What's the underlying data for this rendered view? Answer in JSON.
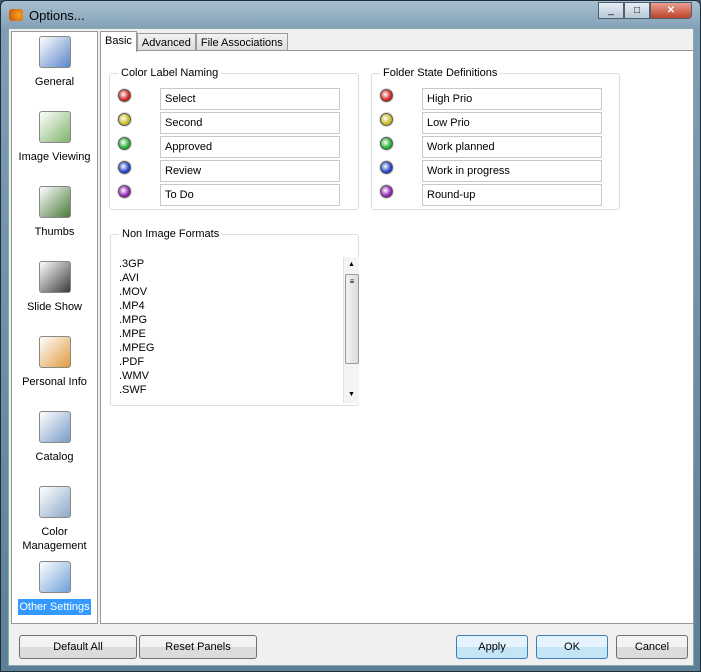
{
  "window": {
    "title": "Options...",
    "controls": [
      "minimize",
      "maximize",
      "close"
    ]
  },
  "sidebar": {
    "items": [
      {
        "label": "General",
        "icon": "general-window-icon",
        "color": "#5b86c9"
      },
      {
        "label": "Image Viewing",
        "icon": "image-viewing-icon",
        "color": "#7fb36a"
      },
      {
        "label": "Thumbs",
        "icon": "thumbs-icon",
        "color": "#4a7a3a"
      },
      {
        "label": "Slide Show",
        "icon": "slide-show-film-icon",
        "color": "#3a3a3a"
      },
      {
        "label": "Personal Info",
        "icon": "personal-info-person-icon",
        "color": "#e09a40"
      },
      {
        "label": "Catalog",
        "icon": "catalog-icon",
        "color": "#7a9cc8"
      },
      {
        "label": "Color Management",
        "icon": "color-management-monitor-icon",
        "color": "#8da8c8"
      },
      {
        "label": "Other Settings",
        "icon": "other-settings-tools-icon",
        "color": "#6fa0d8",
        "selected": true
      }
    ]
  },
  "tabs": [
    {
      "label": "Basic",
      "active": true
    },
    {
      "label": "Advanced"
    },
    {
      "label": "File Associations"
    }
  ],
  "color_label_naming": {
    "title": "Color Label Naming",
    "items": [
      {
        "color": "#d02020",
        "value": "Select"
      },
      {
        "color": "#c8b820",
        "value": "Second"
      },
      {
        "color": "#20b030",
        "value": "Approved"
      },
      {
        "color": "#2040c8",
        "value": "Review"
      },
      {
        "color": "#9020b0",
        "value": "To Do"
      }
    ]
  },
  "folder_state": {
    "title": "Folder State Definitions",
    "items": [
      {
        "color": "#d02020",
        "value": "High Prio"
      },
      {
        "color": "#c8b820",
        "value": "Low Prio"
      },
      {
        "color": "#20b030",
        "value": "Work planned"
      },
      {
        "color": "#2040c8",
        "value": "Work in progress"
      },
      {
        "color": "#9020b0",
        "value": "Round-up"
      }
    ]
  },
  "non_image_formats": {
    "title": "Non Image Formats",
    "items": [
      ".3GP",
      ".AVI",
      ".MOV",
      ".MP4",
      ".MPG",
      ".MPE",
      ".MPEG",
      ".PDF",
      ".WMV",
      ".SWF"
    ]
  },
  "buttons": {
    "default_all": "Default All",
    "reset_panels": "Reset Panels",
    "apply": "Apply",
    "ok": "OK",
    "cancel": "Cancel"
  }
}
